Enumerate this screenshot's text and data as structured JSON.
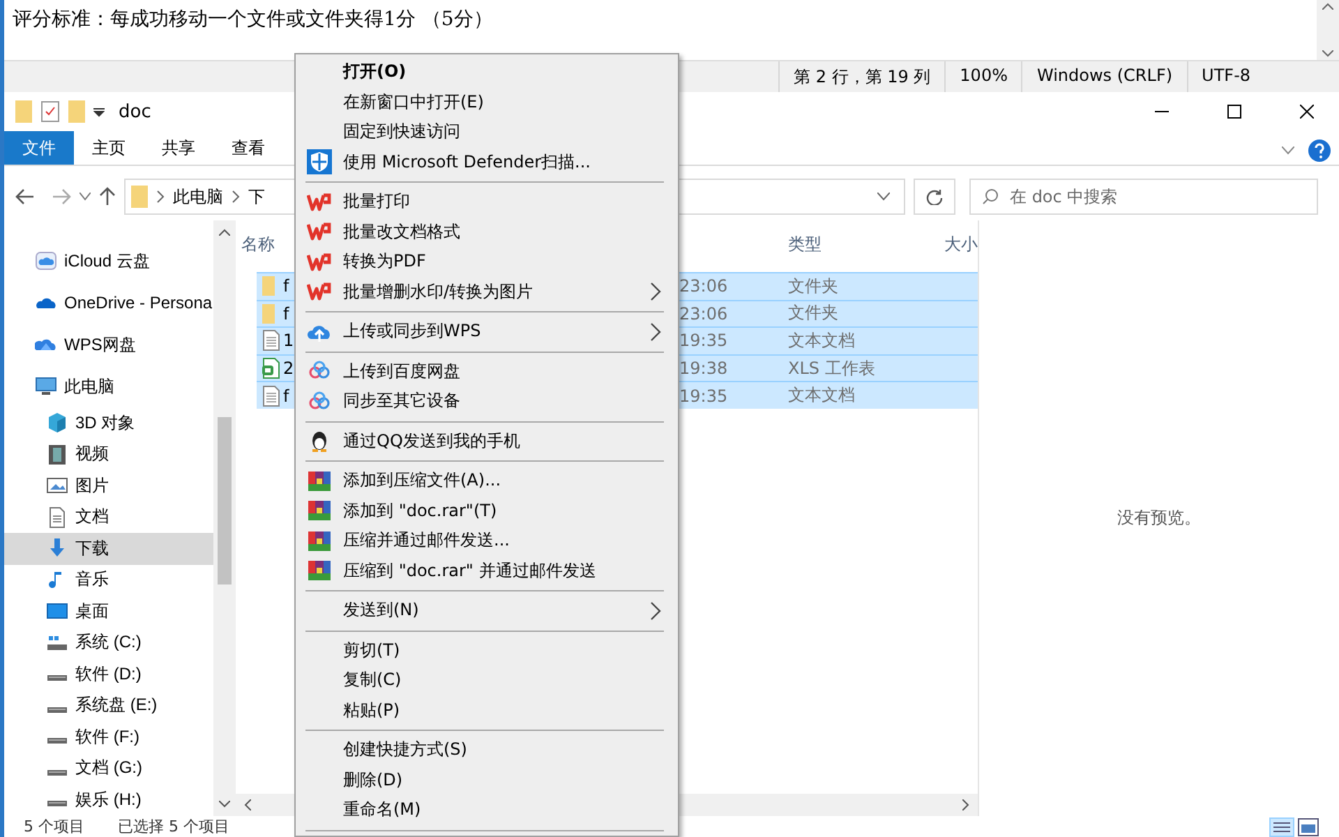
{
  "notepad": {
    "line": "评分标准：每成功移动一个文件或文件夹得1分 （5分）",
    "status": [
      "第 2 行，第 19 列",
      "100%",
      "Windows (CRLF)",
      "UTF-8"
    ]
  },
  "explorer": {
    "title": "doc",
    "ribbon_tabs": [
      {
        "label": "文件",
        "selected": true
      },
      {
        "label": "主页",
        "selected": false
      },
      {
        "label": "共享",
        "selected": false
      },
      {
        "label": "查看",
        "selected": false
      }
    ],
    "path": [
      "此电脑",
      "下"
    ],
    "search": {
      "placeholder": "在 doc 中搜索"
    },
    "nav": [
      {
        "label": "iCloud 云盘",
        "kind": "icloud",
        "selected": false
      },
      {
        "label": "OneDrive - Persona",
        "kind": "onedrive",
        "selected": false
      },
      {
        "label": "WPS网盘",
        "kind": "wpscloud",
        "selected": false
      },
      {
        "label": "此电脑",
        "kind": "pc",
        "selected": false,
        "children": [
          {
            "label": "3D 对象",
            "kind": "cube",
            "selected": false
          },
          {
            "label": "视频",
            "kind": "video",
            "selected": false
          },
          {
            "label": "图片",
            "kind": "image",
            "selected": false
          },
          {
            "label": "文档",
            "kind": "doc",
            "selected": false
          },
          {
            "label": "下载",
            "kind": "download",
            "selected": true
          },
          {
            "label": "音乐",
            "kind": "music",
            "selected": false
          },
          {
            "label": "桌面",
            "kind": "desktop",
            "selected": false
          },
          {
            "label": "系统 (C:)",
            "kind": "sysdrive",
            "selected": false
          },
          {
            "label": "软件 (D:)",
            "kind": "drive",
            "selected": false
          },
          {
            "label": "系统盘 (E:)",
            "kind": "drive",
            "selected": false
          },
          {
            "label": "软件 (F:)",
            "kind": "drive",
            "selected": false
          },
          {
            "label": "文档 (G:)",
            "kind": "drive",
            "selected": false
          },
          {
            "label": "娱乐 (H:)",
            "kind": "drive",
            "selected": false
          }
        ]
      }
    ],
    "columns": [
      "名称",
      "类型",
      "大小"
    ],
    "rows": [
      {
        "name": "f",
        "kind": "folder",
        "time": "23:06",
        "type": "文件夹",
        "selected": true
      },
      {
        "name": "f",
        "kind": "folder",
        "time": "23:06",
        "type": "文件夹",
        "selected": true
      },
      {
        "name": "1",
        "kind": "text",
        "time": "19:35",
        "type": "文本文档",
        "selected": true
      },
      {
        "name": "2",
        "kind": "sheet",
        "time": "19:38",
        "type": "XLS 工作表",
        "selected": true
      },
      {
        "name": "f",
        "kind": "text",
        "time": "19:35",
        "type": "文本文档",
        "selected": true
      }
    ],
    "preview": "没有预览。",
    "status": [
      "5 个项目",
      "已选择 5 个项目"
    ]
  },
  "context_menu": [
    {
      "kind": "item",
      "label": "打开(O)",
      "default": true,
      "submenu": false
    },
    {
      "kind": "item",
      "label": "在新窗口中打开(E)",
      "default": false,
      "submenu": false
    },
    {
      "kind": "item",
      "label": "固定到快速访问",
      "default": false,
      "submenu": false
    },
    {
      "kind": "shield",
      "label": "使用 Microsoft Defender扫描...",
      "default": false,
      "submenu": false
    },
    {
      "kind": "separator"
    },
    {
      "kind": "wps",
      "label": "批量打印",
      "default": false,
      "submenu": false
    },
    {
      "kind": "wps",
      "label": "批量改文档格式",
      "default": false,
      "submenu": false
    },
    {
      "kind": "wps",
      "label": "转换为PDF",
      "default": false,
      "submenu": false
    },
    {
      "kind": "wps",
      "label": "批量增删水印/转换为图片",
      "default": false,
      "submenu": true
    },
    {
      "kind": "separator"
    },
    {
      "kind": "cloud",
      "label": "上传或同步到WPS",
      "default": false,
      "submenu": true
    },
    {
      "kind": "separator"
    },
    {
      "kind": "baidu",
      "label": "上传到百度网盘",
      "default": false,
      "submenu": false
    },
    {
      "kind": "baidu",
      "label": "同步至其它设备",
      "default": false,
      "submenu": false
    },
    {
      "kind": "separator"
    },
    {
      "kind": "qq",
      "label": "通过QQ发送到我的手机",
      "default": false,
      "submenu": false
    },
    {
      "kind": "separator"
    },
    {
      "kind": "archive",
      "label": "添加到压缩文件(A)...",
      "default": false,
      "submenu": false
    },
    {
      "kind": "archive",
      "label": "添加到 \"doc.rar\"(T)",
      "default": false,
      "submenu": false
    },
    {
      "kind": "archive",
      "label": "压缩并通过邮件发送...",
      "default": false,
      "submenu": false
    },
    {
      "kind": "archive",
      "label": "压缩到 \"doc.rar\" 并通过邮件发送",
      "default": false,
      "submenu": false
    },
    {
      "kind": "separator"
    },
    {
      "kind": "item",
      "label": "发送到(N)",
      "default": false,
      "submenu": true
    },
    {
      "kind": "separator"
    },
    {
      "kind": "item",
      "label": "剪切(T)",
      "default": false,
      "submenu": false
    },
    {
      "kind": "item",
      "label": "复制(C)",
      "default": false,
      "submenu": false
    },
    {
      "kind": "item",
      "label": "粘贴(P)",
      "default": false,
      "submenu": false
    },
    {
      "kind": "separator"
    },
    {
      "kind": "item",
      "label": "创建快捷方式(S)",
      "default": false,
      "submenu": false
    },
    {
      "kind": "item",
      "label": "删除(D)",
      "default": false,
      "submenu": false
    },
    {
      "kind": "item",
      "label": "重命名(M)",
      "default": false,
      "submenu": false
    },
    {
      "kind": "separator"
    }
  ]
}
